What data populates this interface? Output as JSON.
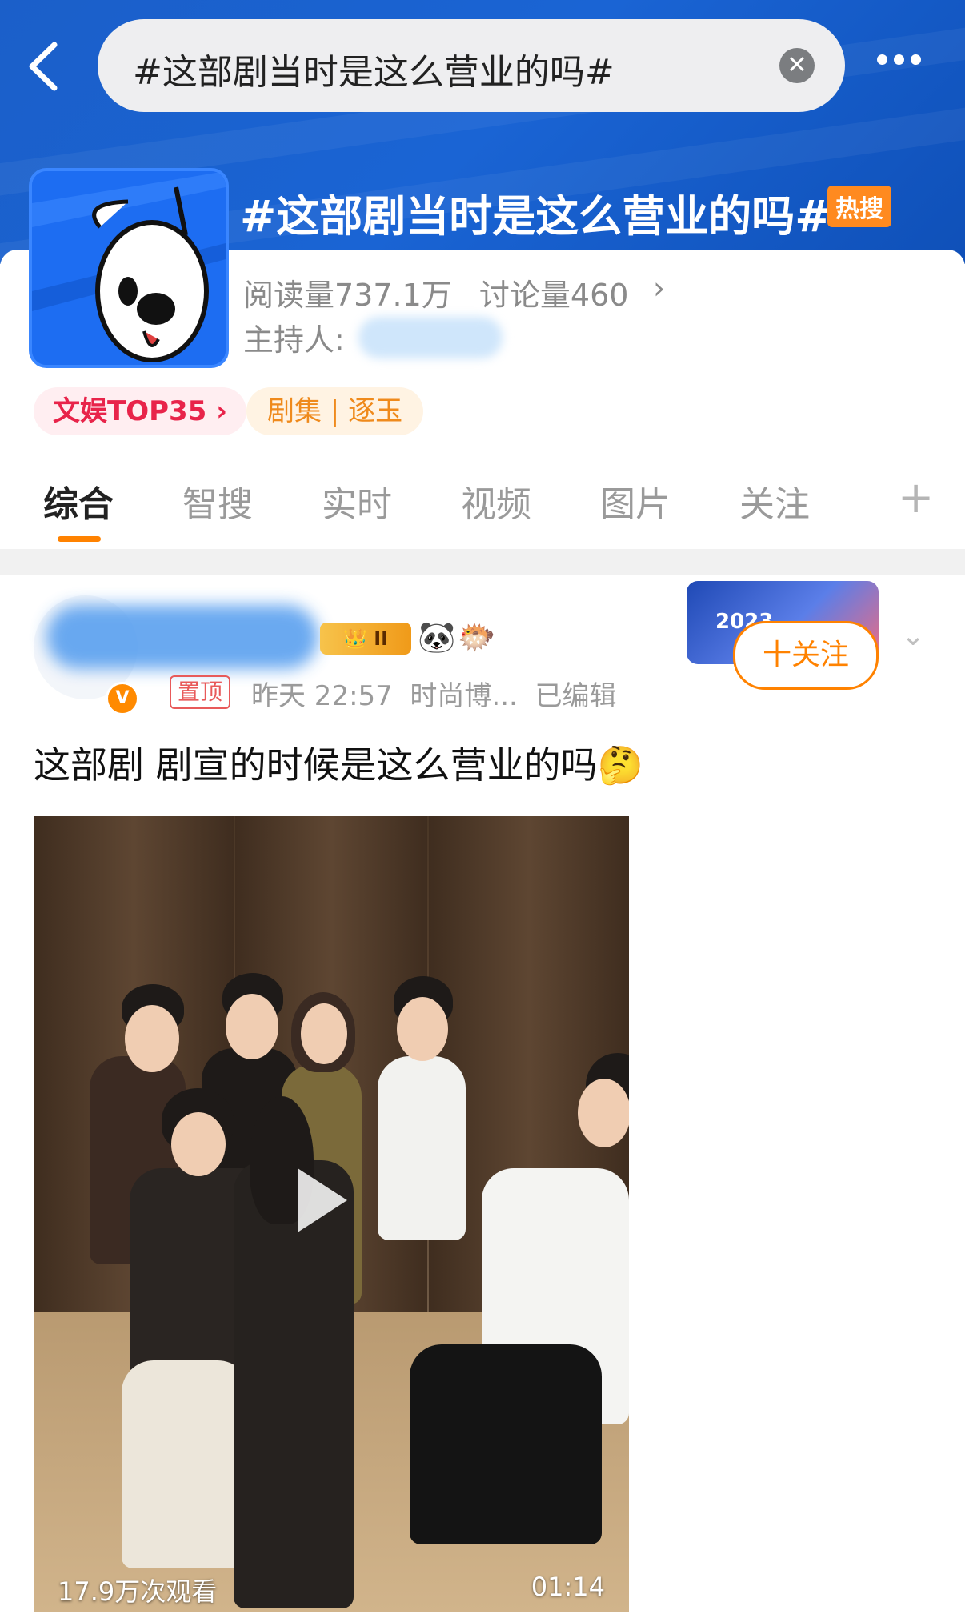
{
  "search": {
    "query": "#这部剧当时是这么营业的吗#"
  },
  "topic": {
    "title": "#这部剧当时是这么营业的吗#",
    "hot_badge": "热搜",
    "reads": "阅读量737.1万",
    "discussions": "讨论量460",
    "host_label": "主持人:",
    "tags": [
      "文娱TOP35 ›",
      "剧集 | 逐玉"
    ]
  },
  "tabs": [
    "综合",
    "智搜",
    "实时",
    "视频",
    "图片",
    "关注"
  ],
  "post": {
    "pinned": "置顶",
    "time": "昨天 22:57",
    "source": "时尚博...",
    "edited": "已编辑",
    "follow": "十关注",
    "badge_year": "2023",
    "vip_level": "II",
    "emojis": [
      "🐼",
      "🐡"
    ],
    "text": "这部剧 剧宣的时候是这么营业的吗",
    "text_emoji": "🤔",
    "video": {
      "views": "17.9万次观看",
      "duration": "01:14"
    }
  },
  "colors": {
    "accent": "#ff8200",
    "header_blue": "#1a64d4",
    "hot": "#ff8a1f",
    "tag_red": "#e8244a"
  },
  "icons": [
    "back-arrow-icon",
    "clear-icon",
    "more-icon",
    "chevron-right-icon",
    "plus-icon",
    "chevron-down-icon",
    "play-icon",
    "verified-icon"
  ]
}
